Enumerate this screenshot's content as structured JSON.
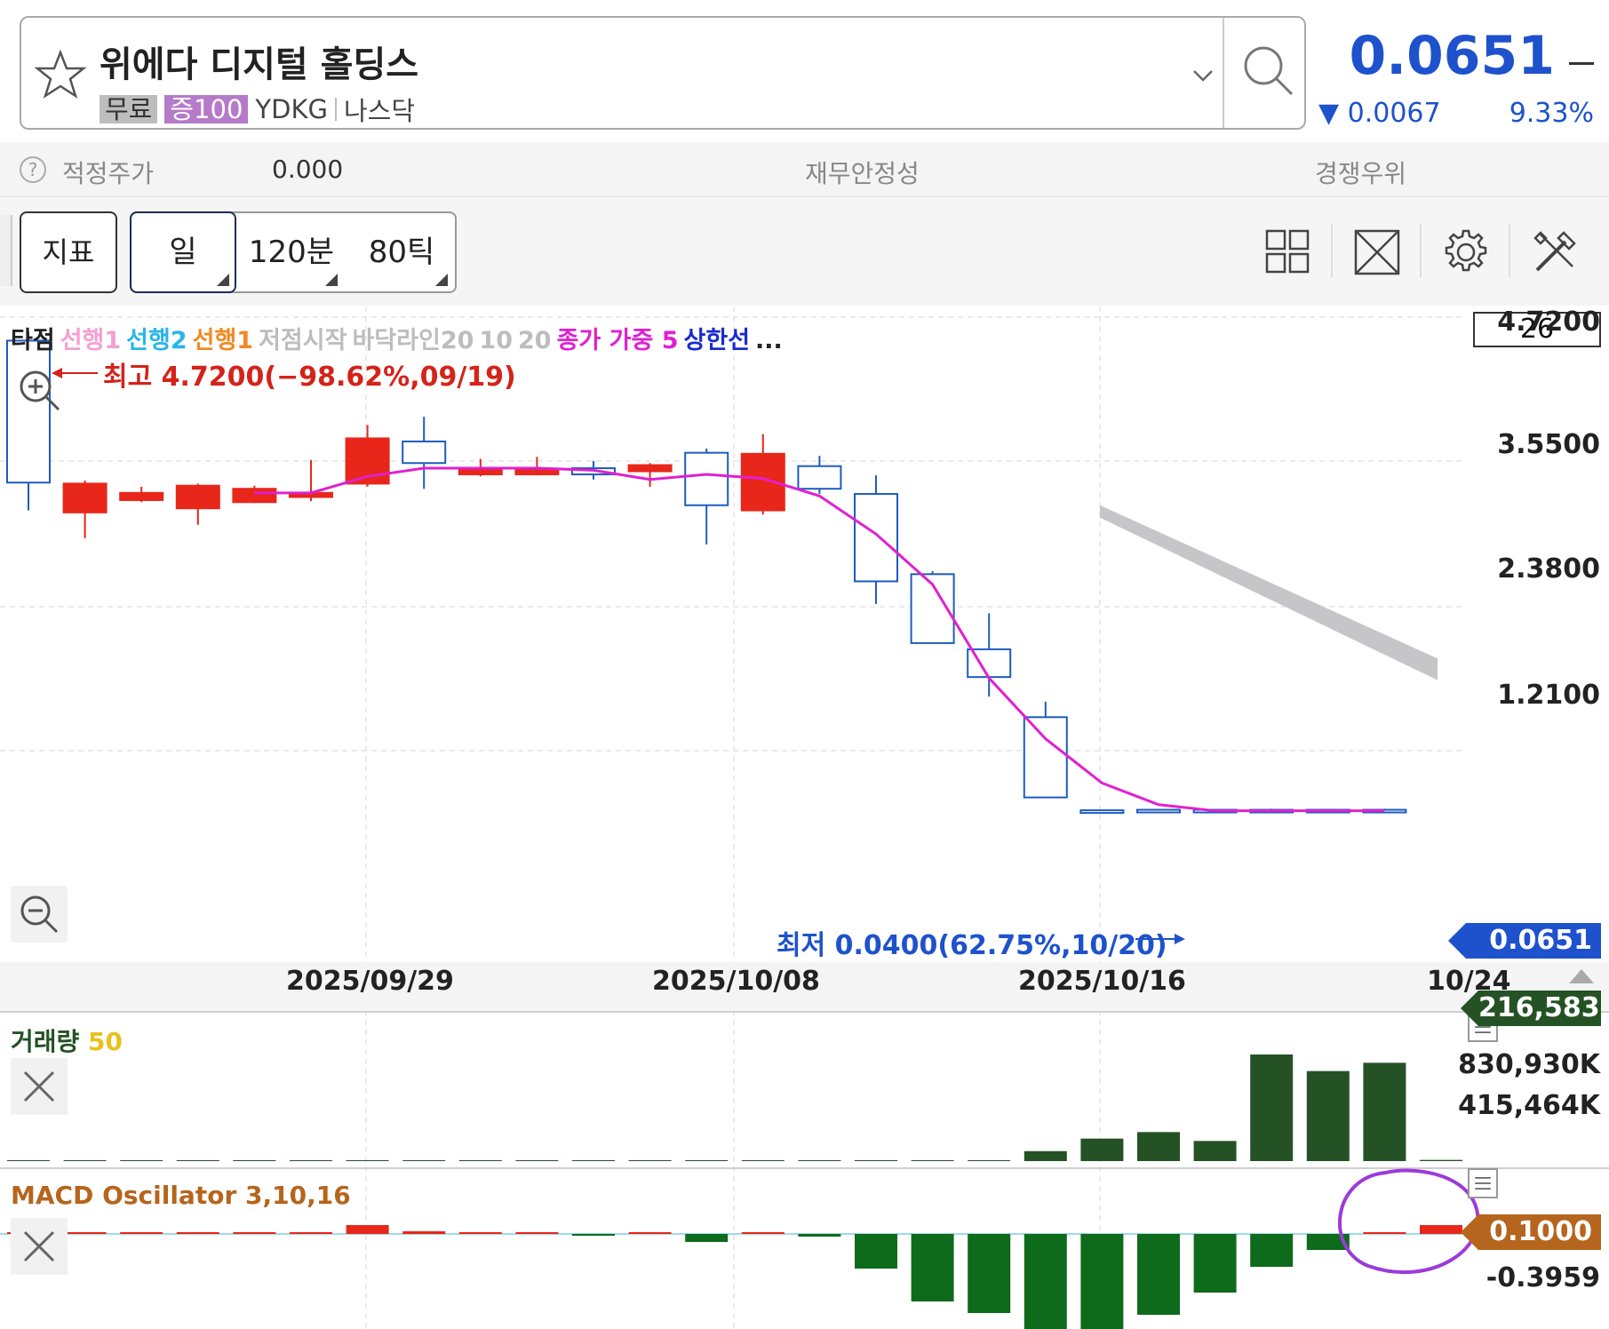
{
  "header": {
    "stock_name": "위에다 디지털 홀딩스",
    "tag_free": "무료",
    "tag_margin": "증100",
    "ticker": "YDKG",
    "market": "나스닥",
    "price": "0.0651",
    "change": "▼ 0.0067",
    "change_pct": "9.33%",
    "price_color": "#1e52cc"
  },
  "info_bar": {
    "help": "?",
    "fair_price_label": "적정주가",
    "fair_price_value": "0.000",
    "financial_label": "재무안정성",
    "competitive_label": "경쟁우위"
  },
  "toolbar": {
    "indicator_label": "지표",
    "periods": [
      "일",
      "120분",
      "80틱"
    ],
    "icons": [
      "layout-grid-icon",
      "fullscreen-icon",
      "settings-gear-icon",
      "tools-icon"
    ]
  },
  "chart": {
    "legend": [
      {
        "text": "타점",
        "color": "#222222"
      },
      {
        "text": "선행1",
        "color": "#f4a0d0"
      },
      {
        "text": "선행2",
        "color": "#29b6e8"
      },
      {
        "text": "선행1",
        "color": "#f08a24"
      },
      {
        "text": "저점시작",
        "color": "#bdbdbd"
      },
      {
        "text": "바닥라인20",
        "color": "#bdbdbd"
      },
      {
        "text": "10",
        "color": "#bdbdbd"
      },
      {
        "text": "20",
        "color": "#bdbdbd"
      },
      {
        "text": "종가 가중 5",
        "color": "#e020d0"
      },
      {
        "text": "상한선",
        "color": "#1a2bd0"
      },
      {
        "text": "...",
        "color": "#222222"
      }
    ],
    "count_box": "26",
    "high_label": "최고 4.7200(−98.62%,09/19)",
    "low_label": "최저 0.0400(62.75%,10/20)",
    "y_ticks": [
      "4.7200",
      "3.5500",
      "2.3800",
      "1.2100"
    ],
    "current_price_tag": "0.0651",
    "x_ticks": [
      "2025/09/29",
      "2025/10/08",
      "2025/10/16",
      "10/24"
    ]
  },
  "chart_data": [
    {
      "type": "candlestick",
      "title": "",
      "x_labels": [
        "2025/09/29",
        "2025/10/08",
        "2025/10/16",
        "10/24"
      ],
      "ylim": [
        0.04,
        4.72
      ],
      "candles": [
        {
          "o": 3.25,
          "h": 4.72,
          "l": 2.98,
          "c": 4.63,
          "dir": "down"
        },
        {
          "o": 3.24,
          "h": 3.27,
          "l": 2.71,
          "c": 2.96,
          "dir": "up"
        },
        {
          "o": 3.15,
          "h": 3.21,
          "l": 3.06,
          "c": 3.08,
          "dir": "up"
        },
        {
          "o": 3.22,
          "h": 3.24,
          "l": 2.84,
          "c": 3.0,
          "dir": "up"
        },
        {
          "o": 3.19,
          "h": 3.22,
          "l": 3.05,
          "c": 3.06,
          "dir": "up"
        },
        {
          "o": 3.15,
          "h": 3.47,
          "l": 3.07,
          "c": 3.11,
          "dir": "up"
        },
        {
          "o": 3.68,
          "h": 3.81,
          "l": 3.21,
          "c": 3.24,
          "dir": "up"
        },
        {
          "o": 3.44,
          "h": 3.89,
          "l": 3.19,
          "c": 3.65,
          "dir": "down"
        },
        {
          "o": 3.38,
          "h": 3.48,
          "l": 3.31,
          "c": 3.33,
          "dir": "up"
        },
        {
          "o": 3.38,
          "h": 3.5,
          "l": 3.32,
          "c": 3.33,
          "dir": "up"
        },
        {
          "o": 3.33,
          "h": 3.46,
          "l": 3.28,
          "c": 3.39,
          "dir": "down"
        },
        {
          "o": 3.42,
          "h": 3.44,
          "l": 3.21,
          "c": 3.36,
          "dir": "up"
        },
        {
          "o": 3.03,
          "h": 3.58,
          "l": 2.65,
          "c": 3.54,
          "dir": "down"
        },
        {
          "o": 3.53,
          "h": 3.72,
          "l": 2.94,
          "c": 2.98,
          "dir": "up"
        },
        {
          "o": 3.19,
          "h": 3.51,
          "l": 3.14,
          "c": 3.41,
          "dir": "down"
        },
        {
          "o": 2.29,
          "h": 3.32,
          "l": 2.07,
          "c": 3.14,
          "dir": "down"
        },
        {
          "o": 1.69,
          "h": 2.39,
          "l": 1.69,
          "c": 2.36,
          "dir": "down"
        },
        {
          "o": 1.36,
          "h": 1.98,
          "l": 1.17,
          "c": 1.63,
          "dir": "down"
        },
        {
          "o": 0.19,
          "h": 1.12,
          "l": 0.19,
          "c": 0.97,
          "dir": "down"
        },
        {
          "o": 0.06,
          "h": 0.07,
          "l": 0.05,
          "c": 0.065,
          "dir": "down"
        },
        {
          "o": 0.07,
          "h": 0.075,
          "l": 0.06,
          "c": 0.065,
          "dir": "down"
        },
        {
          "o": 0.07,
          "h": 0.075,
          "l": 0.06,
          "c": 0.065,
          "dir": "down"
        },
        {
          "o": 0.07,
          "h": 0.08,
          "l": 0.06,
          "c": 0.065,
          "dir": "down"
        },
        {
          "o": 0.07,
          "h": 0.08,
          "l": 0.06,
          "c": 0.065,
          "dir": "down"
        },
        {
          "o": 0.07,
          "h": 0.08,
          "l": 0.06,
          "c": 0.0651,
          "dir": "down"
        }
      ],
      "weighted_close_5": [
        null,
        null,
        null,
        null,
        3.15,
        3.15,
        3.31,
        3.39,
        3.39,
        3.39,
        3.37,
        3.28,
        3.33,
        3.29,
        3.12,
        2.75,
        2.26,
        1.35,
        0.76,
        0.33,
        0.12,
        0.06,
        0.06,
        0.06,
        0.06
      ],
      "cloud": {
        "start": [
          3.03,
          2.91
        ],
        "end": [
          1.54,
          1.33
        ]
      }
    },
    {
      "type": "bar",
      "title": "거래량 50",
      "values": [
        3000,
        3000,
        3000,
        3000,
        3000,
        3000,
        3000,
        3000,
        3000,
        3000,
        3000,
        3000,
        3000,
        3000,
        3000,
        3000,
        3000,
        4000,
        84000,
        190000,
        245000,
        170000,
        900000,
        760000,
        830000,
        10000
      ],
      "y_ticks": [
        "830,930K",
        "415,464K"
      ],
      "last_value_tag": "216,583",
      "color": "#245225"
    },
    {
      "type": "bar",
      "title": "MACD Oscillator 3,10,16",
      "values": [
        0.002,
        0.0,
        0.001,
        0.0,
        0.0,
        0.0,
        0.1,
        0.03,
        0.01,
        0.01,
        -0.01,
        0.01,
        -0.09,
        0.01,
        -0.03,
        -0.39,
        -0.76,
        -0.89,
        -1.21,
        -1.16,
        -0.91,
        -0.66,
        -0.37,
        -0.18,
        0.01,
        0.1
      ],
      "y_ticks": [
        "-0.3959"
      ],
      "last_value_tag": "0.1000",
      "up_color": "#e8261a",
      "down_color": "#0f6b1c"
    }
  ]
}
